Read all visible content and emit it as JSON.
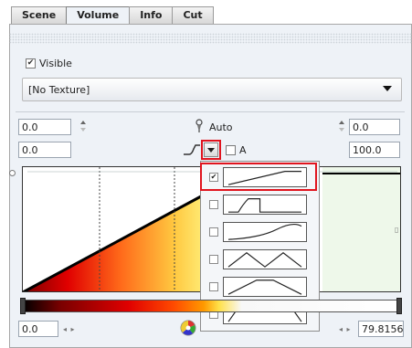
{
  "tabs": [
    "Scene",
    "Volume",
    "Info",
    "Cut"
  ],
  "active_tab": "Volume",
  "visible": {
    "label": "Visible",
    "checked": true
  },
  "texture": {
    "selected": "[No Texture]"
  },
  "auto_label": "Auto",
  "range_min": {
    "value": "0.0"
  },
  "range_max": {
    "value": "0.0"
  },
  "opacity_min": {
    "value": "0.0"
  },
  "opacity_max": {
    "value": "100.0"
  },
  "a_label": "A",
  "slider_left": {
    "value": "0.0"
  },
  "slider_right": {
    "value": "79.8156"
  },
  "transfer_shapes": [
    {
      "name": "linear-ramp",
      "checked": true
    },
    {
      "name": "step",
      "checked": false
    },
    {
      "name": "smooth-ramp",
      "checked": false
    },
    {
      "name": "double-peak",
      "checked": false
    },
    {
      "name": "trapezoid",
      "checked": false
    },
    {
      "name": "inverted-trapezoid",
      "checked": false
    }
  ],
  "colors": {
    "highlight": "#e0141e",
    "panel_bg": "#eef2f7"
  },
  "icons": [
    "pin-icon",
    "curve-icon",
    "dropdown-arrow-icon",
    "color-wheel-icon"
  ]
}
